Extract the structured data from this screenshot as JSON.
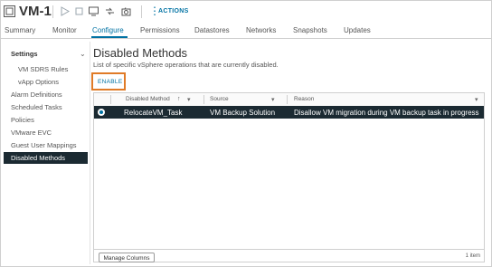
{
  "header": {
    "title": "VM-1",
    "icons": [
      "vm-icon",
      "power-on-icon",
      "power-off-icon",
      "console-icon",
      "migrate-icon",
      "snapshot-icon"
    ],
    "actions_label": "ACTIONS"
  },
  "tabs": [
    {
      "label": "Summary"
    },
    {
      "label": "Monitor"
    },
    {
      "label": "Configure",
      "active": true
    },
    {
      "label": "Permissions"
    },
    {
      "label": "Datastores"
    },
    {
      "label": "Networks"
    },
    {
      "label": "Snapshots"
    },
    {
      "label": "Updates"
    }
  ],
  "nav": {
    "settings_label": "Settings",
    "items": [
      {
        "label": "VM SDRS Rules"
      },
      {
        "label": "vApp Options"
      },
      {
        "label": "Alarm Definitions"
      },
      {
        "label": "Scheduled Tasks"
      },
      {
        "label": "Policies"
      },
      {
        "label": "VMware EVC"
      },
      {
        "label": "Guest User Mappings"
      },
      {
        "label": "Disabled Methods",
        "selected": true
      }
    ]
  },
  "content": {
    "title": "Disabled Methods",
    "subtitle": "List of specific vSphere operations that are currently disabled.",
    "enable_label": "ENABLE"
  },
  "grid": {
    "columns": [
      "Disabled Method",
      "Source",
      "Reason"
    ],
    "rows": [
      [
        "RelocateVM_Task",
        "VM Backup Solution",
        "Disallow VM migration during VM backup task in progress"
      ]
    ],
    "manage_label": "Manage Columns",
    "count_label": "1 item"
  },
  "colors": {
    "accent": "#0072a3",
    "selected_bg": "#1b2a32",
    "highlight_box": "#e07b27"
  }
}
